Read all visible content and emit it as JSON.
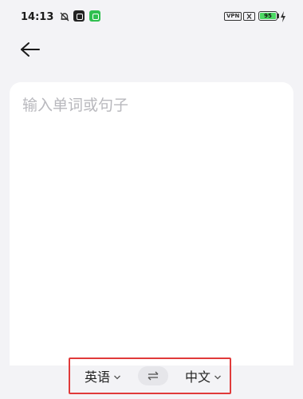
{
  "status_bar": {
    "time": "14:13",
    "vpn_label": "VPN",
    "battery_level": "95",
    "icons": [
      "bell-off-icon",
      "app-notification-icon",
      "app-notification-icon",
      "vpn-icon",
      "sim-off-icon",
      "battery-icon",
      "charging-icon"
    ]
  },
  "header": {
    "back_icon": "arrow-left-icon"
  },
  "input": {
    "placeholder": "输入单词或句子",
    "value": ""
  },
  "language_bar": {
    "source_language": "英语",
    "target_language": "中文",
    "swap_icon": "swap-arrows-icon",
    "highlight_color": "#e03a3a"
  }
}
